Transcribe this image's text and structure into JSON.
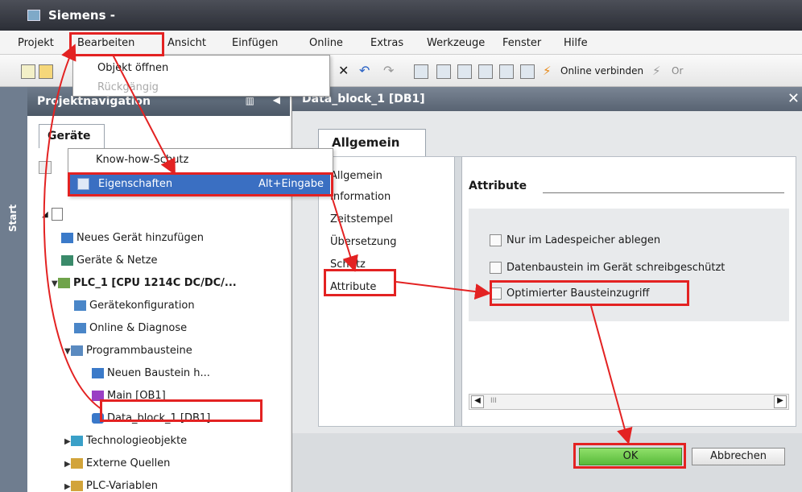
{
  "window": {
    "title": "Siemens  -",
    "accent": "#e32222"
  },
  "menubar": {
    "items": [
      "Projekt",
      "Bearbeiten",
      "Ansicht",
      "Einfügen",
      "Online",
      "Extras",
      "Werkzeuge",
      "Fenster",
      "Hilfe"
    ]
  },
  "toolbar": {
    "online_connect": "Online verbinden",
    "online_cut": "Or"
  },
  "edit_menu": {
    "open_object": "Objekt öffnen",
    "undo": "Rückgängig"
  },
  "left_panel": {
    "vertical_tab": "Start",
    "header": "Projektnavigation",
    "tab": "Geräte",
    "context_menu": {
      "know_how": "Know-how-Schutz",
      "properties": "Eigenschaften",
      "properties_shortcut": "Alt+Eingabe"
    },
    "tree": [
      "Neues Gerät hinzufügen",
      "Geräte & Netze",
      "PLC_1 [CPU 1214C DC/DC/...",
      "Gerätekonfiguration",
      "Online & Diagnose",
      "Programmbausteine",
      "Neuen Baustein h...",
      "Main [OB1]",
      "Data_block_1 [DB1]",
      "Technologieobjekte",
      "Externe Quellen",
      "PLC-Variablen"
    ]
  },
  "dialog": {
    "title": "Data_block_1 [DB1]",
    "tab": "Allgemein",
    "nav": [
      "Allgemein",
      "Information",
      "Zeitstempel",
      "Übersetzung",
      "Schutz",
      "Attribute"
    ],
    "section": "Attribute",
    "checkboxes": [
      {
        "label": "Nur im Ladespeicher ablegen",
        "checked": false
      },
      {
        "label": "Datenbaustein im Gerät schreibgeschützt",
        "checked": false
      },
      {
        "label": "Optimierter Bausteinzugriff",
        "checked": false
      }
    ],
    "scroll_mark": "III",
    "ok": "OK",
    "cancel": "Abbrechen"
  }
}
